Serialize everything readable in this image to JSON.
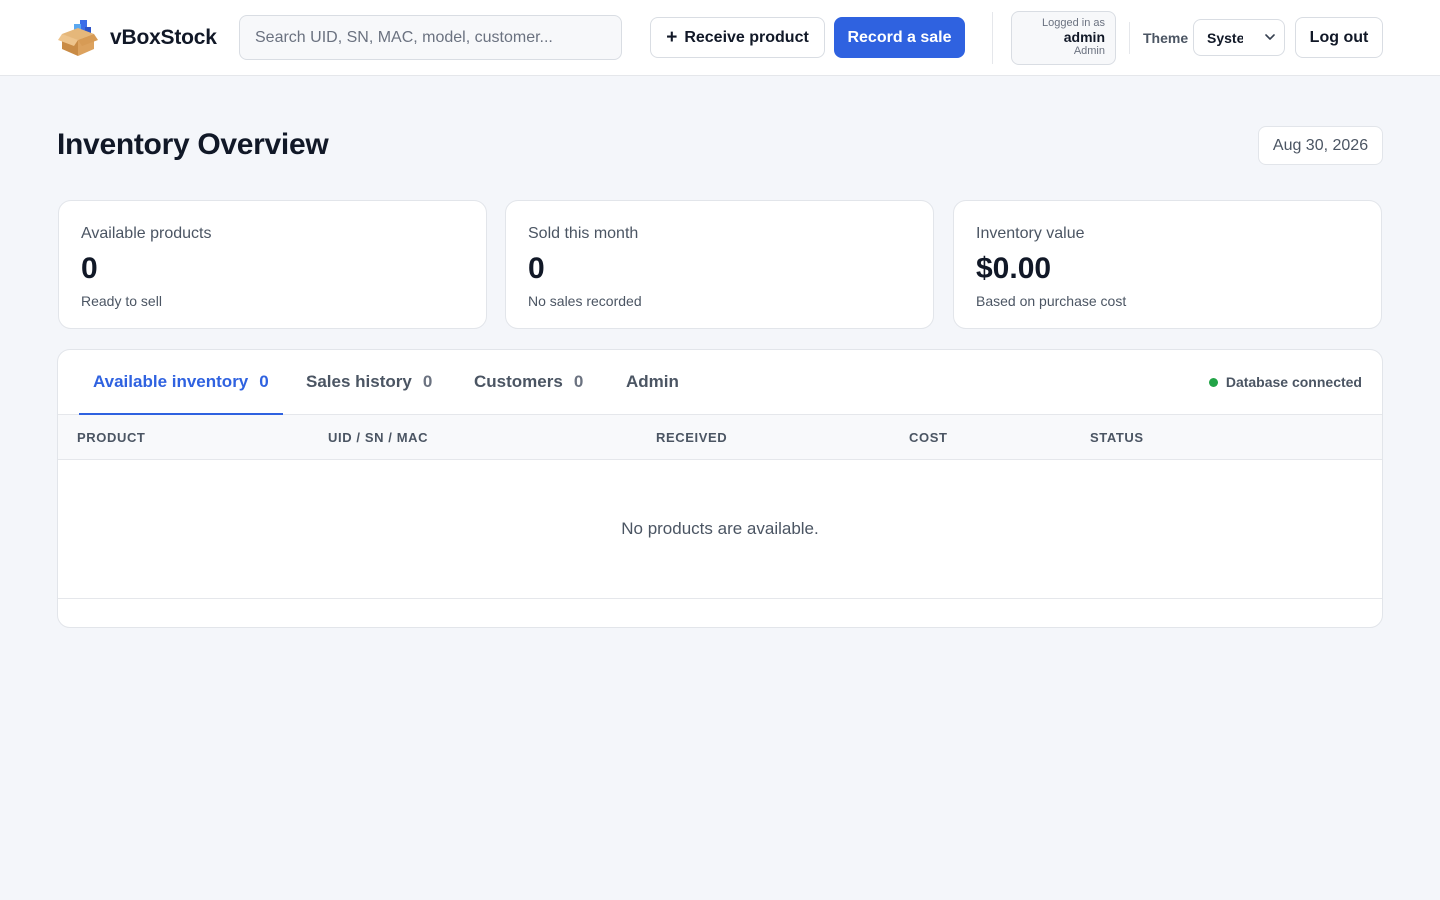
{
  "header": {
    "app_name": "vBoxStock",
    "search_placeholder": "Search UID, SN, MAC, model, customer...",
    "receive_button": "Receive product",
    "sale_button": "Record a sale",
    "user": {
      "logged_in_label": "Logged in as",
      "username": "admin",
      "role": "Admin"
    },
    "theme_label": "Theme",
    "theme_value": "System",
    "logout_button": "Log out"
  },
  "page": {
    "title": "Inventory Overview",
    "date": "Aug 30, 2026"
  },
  "stats": [
    {
      "label": "Available products",
      "value": "0",
      "sub": "Ready to sell"
    },
    {
      "label": "Sold this month",
      "value": "0",
      "sub": "No sales recorded"
    },
    {
      "label": "Inventory value",
      "value": "$0.00",
      "sub": "Based on purchase cost"
    }
  ],
  "tabs": [
    {
      "label": "Available inventory",
      "count": "0",
      "active": true
    },
    {
      "label": "Sales history",
      "count": "0"
    },
    {
      "label": "Customers",
      "count": "0"
    },
    {
      "label": "Admin"
    }
  ],
  "db_status": "Database connected",
  "table": {
    "columns": [
      "PRODUCT",
      "UID / SN / MAC",
      "RECEIVED",
      "COST",
      "STATUS"
    ],
    "empty_message": "No products are available."
  },
  "colors": {
    "accent": "#2f62e0",
    "status_ok": "#22a447",
    "background": "#f4f6fa"
  }
}
